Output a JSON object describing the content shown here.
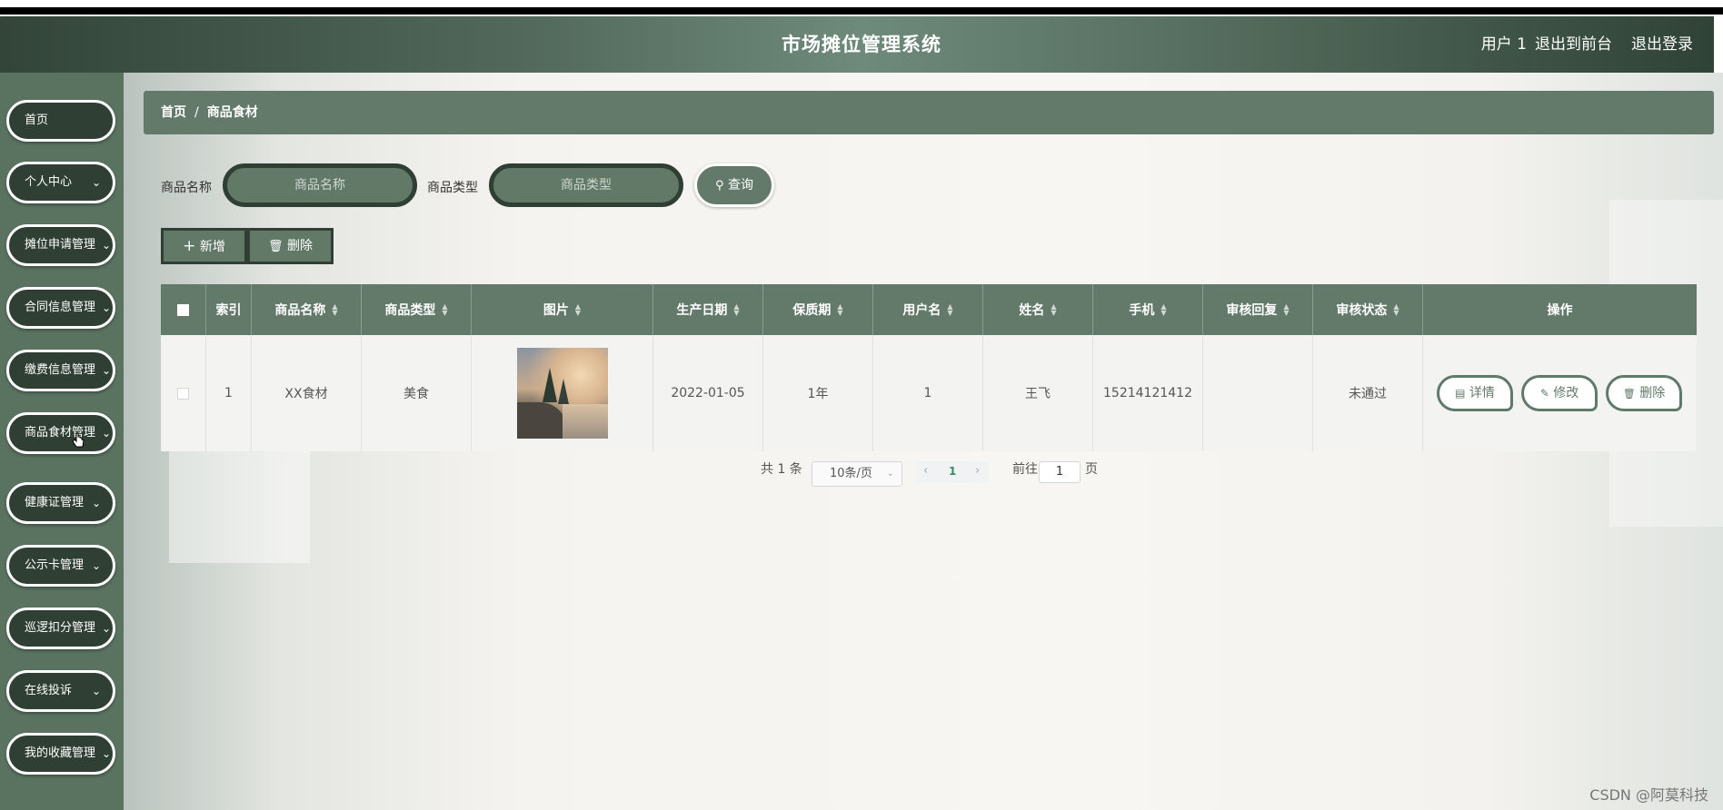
{
  "app": {
    "title": "市场摊位管理系统",
    "user": "用户 1",
    "to_front": "退出到前台",
    "logout": "退出登录"
  },
  "sidebar": {
    "items": [
      {
        "label": "首页",
        "has_arrow": false
      },
      {
        "label": "个人中心",
        "has_arrow": true
      },
      {
        "label": "摊位申请管理",
        "has_arrow": true
      },
      {
        "label": "合同信息管理",
        "has_arrow": true
      },
      {
        "label": "缴费信息管理",
        "has_arrow": true
      },
      {
        "label": "商品食材管理",
        "has_arrow": true
      },
      {
        "label": "健康证管理",
        "has_arrow": true
      },
      {
        "label": "公示卡管理",
        "has_arrow": true
      },
      {
        "label": "巡逻扣分管理",
        "has_arrow": true
      },
      {
        "label": "在线投诉",
        "has_arrow": true
      },
      {
        "label": "我的收藏管理",
        "has_arrow": true
      }
    ]
  },
  "breadcrumb": {
    "home": "首页",
    "sep": "/",
    "current": "商品食材"
  },
  "filters": {
    "name_label": "商品名称",
    "name_placeholder": "商品名称",
    "type_label": "商品类型",
    "type_placeholder": "商品类型",
    "query_label": "查询"
  },
  "actions": {
    "add_label": "新增",
    "delete_label": "删除"
  },
  "table": {
    "columns": [
      "索引",
      "商品名称",
      "商品类型",
      "图片",
      "生产日期",
      "保质期",
      "用户名",
      "姓名",
      "手机",
      "审核回复",
      "审核状态",
      "操作"
    ],
    "rows": [
      {
        "index": "1",
        "name": "XX食材",
        "type": "美食",
        "date": "2022-01-05",
        "shelf_life": "1年",
        "username": "1",
        "realname": "王飞",
        "phone": "15214121412",
        "reply": "",
        "status": "未通过"
      }
    ],
    "row_actions": {
      "detail": "详情",
      "edit": "修改",
      "delete": "删除"
    }
  },
  "pagination": {
    "total": "共 1 条",
    "page_size": "10条/页",
    "current": "1",
    "goto_prefix": "前往",
    "goto_value": "1",
    "goto_suffix": "页"
  },
  "watermark": "CSDN @阿莫科技",
  "colors": {
    "header": "#51685a",
    "sidebar": "#5a7361",
    "menu": "#2f3f33",
    "table_head": "#637a6a"
  }
}
